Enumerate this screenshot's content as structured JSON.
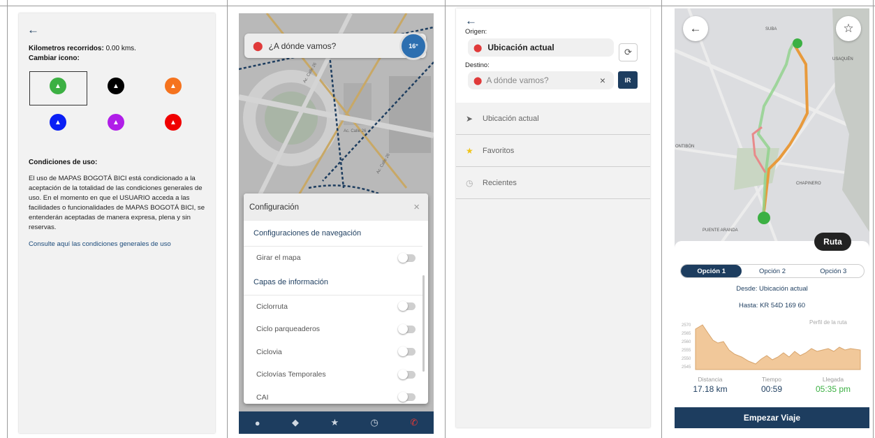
{
  "panel1": {
    "km_label": "Kilometros recorridos:",
    "km_value": "0.00 kms.",
    "change_icon": "Cambiar icono:",
    "icon_colors": [
      "#3cb043",
      "#000000",
      "#f5731e",
      "#0a1ff5",
      "#b01ee8",
      "#f00000"
    ],
    "terms_title": "Condiciones de uso:",
    "terms_text": "El uso de MAPAS BOGOTÁ BICI está condicionado a la aceptación de la totalidad de las condiciones generales de uso. En el momento en que el USUARIO acceda a las facilidades o funcionalidades de MAPAS BOGOTÁ BICI, se entenderán aceptadas de manera expresa, plena y sin reservas.",
    "terms_link": "Consulte aquí las condiciones generales de uso"
  },
  "panel2": {
    "search_placeholder": "¿A dónde vamos?",
    "temperature": "16°",
    "config_title": "Configuración",
    "close": "×",
    "nav_section": "Configuraciones de navegación",
    "rotate_map": "Girar el mapa",
    "layers_section": "Capas de información",
    "layers": [
      "Ciclorruta",
      "Ciclo parqueaderos",
      "Ciclovia",
      "Ciclovías Temporales",
      "CAI"
    ],
    "map_labels": [
      "Ac. Calle 26",
      "Ac. Calle 26",
      "Ac. Calle 26"
    ]
  },
  "panel3": {
    "origin_label": "Origen:",
    "origin_value": "Ubicación actual",
    "dest_label": "Destino:",
    "dest_placeholder": "A dónde vamos?",
    "clear": "×",
    "go": "IR",
    "options": [
      "Ubicación actual",
      "Favoritos",
      "Recientes"
    ]
  },
  "panel4": {
    "map_labels": [
      "SUBA",
      "USAQUÉN",
      "ONTIBÓN",
      "CHAPINERO",
      "PUENTE ARANDA"
    ],
    "route_badge": "Ruta",
    "tabs": [
      "Opción 1",
      "Opción 2",
      "Opción 3"
    ],
    "from": "Desde: Ubicación actual",
    "to": "Hasta: KR 54D 169 60",
    "profile_label": "Perfil de la ruta",
    "elevation_ticks": [
      "2570",
      "2565",
      "2560",
      "2555",
      "2550",
      "2545"
    ],
    "stats": [
      {
        "label": "Distancia",
        "value": "17.18 km"
      },
      {
        "label": "Tiempo",
        "value": "00:59"
      },
      {
        "label": "Llegada",
        "value": "05:35 pm"
      }
    ],
    "start_button": "Empezar Viaje"
  }
}
